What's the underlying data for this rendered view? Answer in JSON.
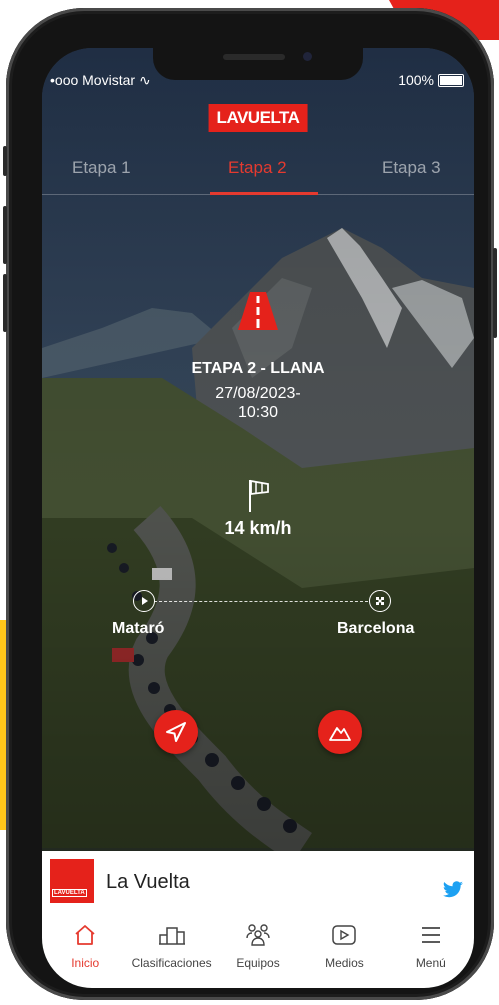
{
  "status": {
    "carrier": "•ooo Movistar",
    "battery": "100%"
  },
  "brand": {
    "logo_text": "LAVUELTA",
    "red": "#e5221b",
    "accent": "#e53a2f"
  },
  "tabs": [
    "Etapa 1",
    "Etapa 2",
    "Etapa 3"
  ],
  "active_tab": "Etapa 2",
  "stage": {
    "icon": "road-icon",
    "title": "ETAPA 2 - LLANA",
    "date": "27/08/2023-",
    "time": "10:30",
    "wind_icon": "windsock-icon",
    "wind_speed": "14 km/h",
    "origin": "Mataró",
    "destination": "Barcelona"
  },
  "actions": {
    "navigate_icon": "navigation-arrow-icon",
    "profile_icon": "mountain-icon"
  },
  "feed": {
    "logo_text": "LAVUELTA",
    "title": "La Vuelta",
    "source_icon": "twitter-icon"
  },
  "bottom_nav": [
    {
      "label": "Inicio",
      "icon": "home-icon",
      "active": true
    },
    {
      "label": "Clasificaciones",
      "icon": "podium-icon",
      "active": false
    },
    {
      "label": "Equipos",
      "icon": "team-icon",
      "active": false
    },
    {
      "label": "Medios",
      "icon": "play-icon",
      "active": false
    },
    {
      "label": "Menú",
      "icon": "menu-icon",
      "active": false
    }
  ]
}
